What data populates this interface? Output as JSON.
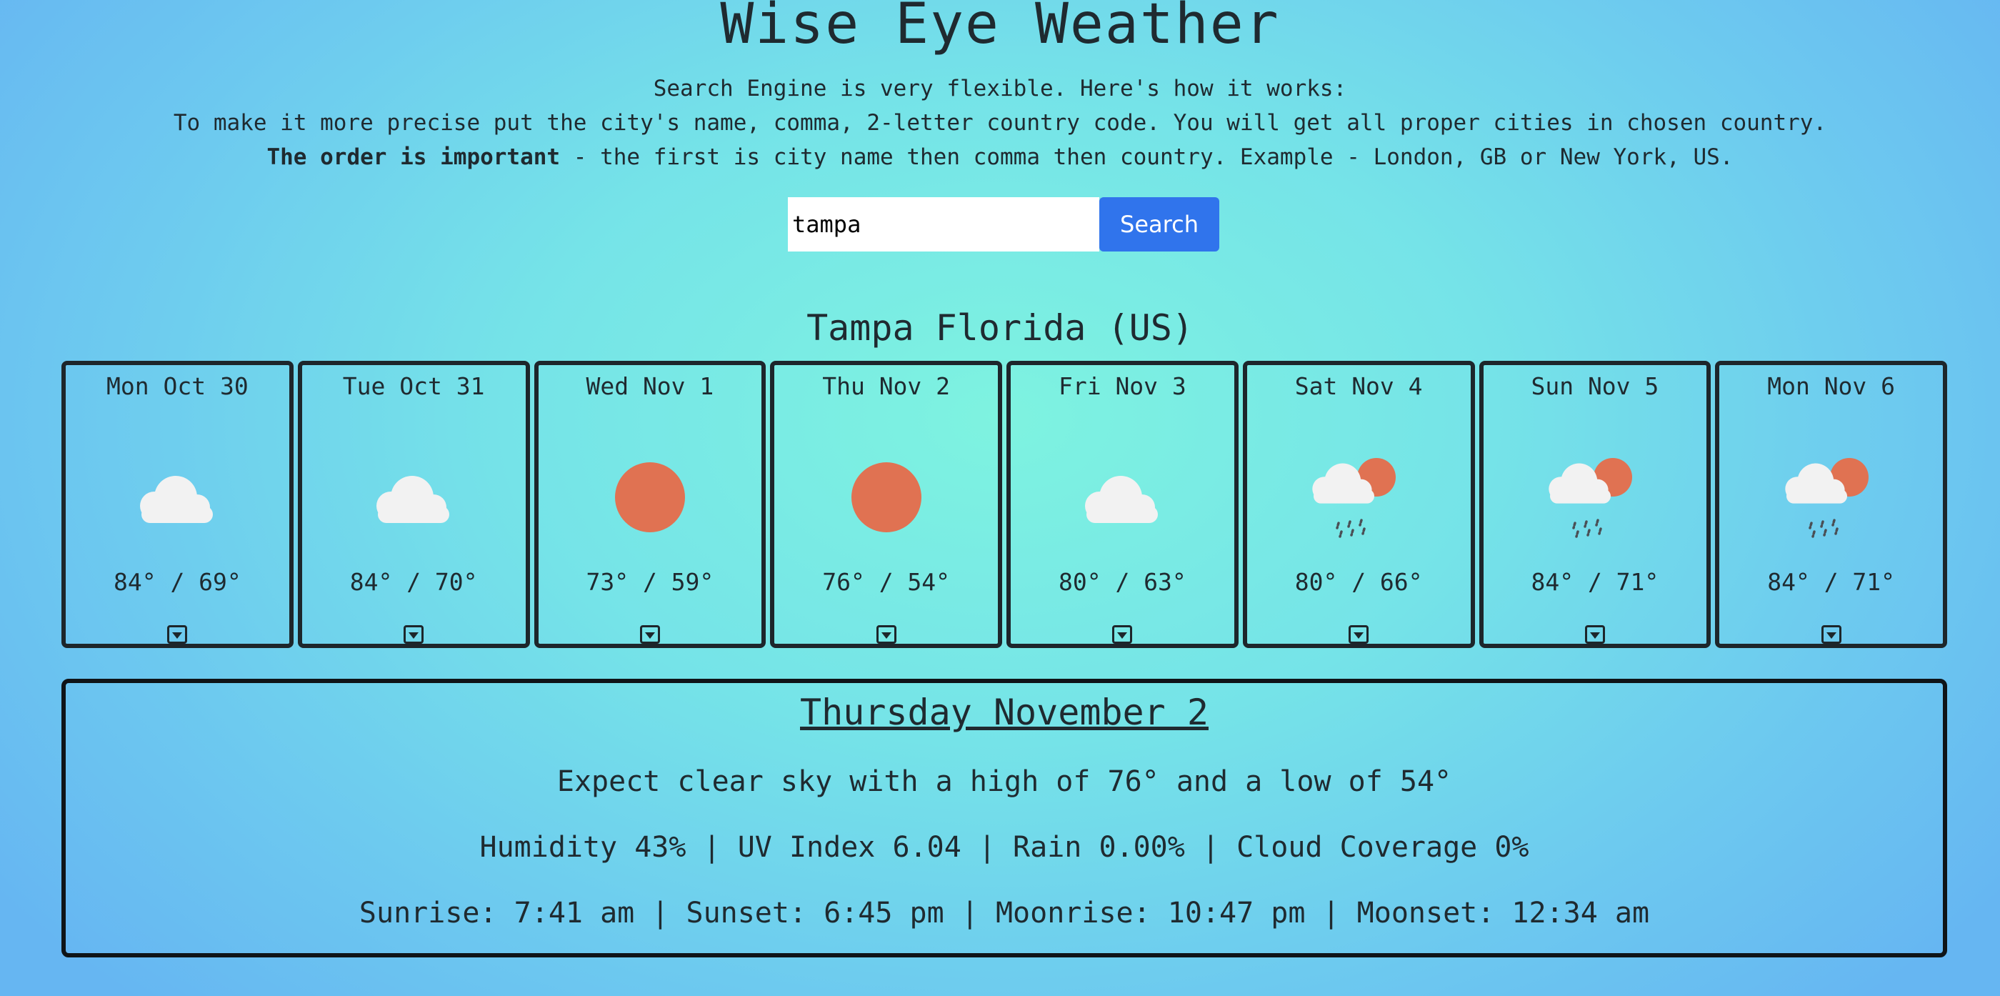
{
  "app": {
    "title": "Wise Eye Weather"
  },
  "instructions": {
    "line1": "Search Engine is very flexible. Here's how it works:",
    "line2": "To make it more precise put the city's name, comma, 2-letter country code. You will get all proper cities in chosen country.",
    "line3_bold": "The order is important",
    "line3_rest": " - the first is city name then comma then country. Example - London, GB or New York, US."
  },
  "search": {
    "value": "tampa",
    "button_label": "Search"
  },
  "location": {
    "title": "Tampa Florida (US)"
  },
  "forecast": [
    {
      "day": "Mon Oct 30",
      "temps": "84° / 69°",
      "icon": "cloud-icon"
    },
    {
      "day": "Tue Oct 31",
      "temps": "84° / 70°",
      "icon": "cloud-icon"
    },
    {
      "day": "Wed Nov 1",
      "temps": "73° / 59°",
      "icon": "sun-icon"
    },
    {
      "day": "Thu Nov 2",
      "temps": "76° / 54°",
      "icon": "sun-icon"
    },
    {
      "day": "Fri Nov 3",
      "temps": "80° / 63°",
      "icon": "cloud-icon"
    },
    {
      "day": "Sat Nov 4",
      "temps": "80° / 66°",
      "icon": "rain-sun-icon"
    },
    {
      "day": "Sun Nov 5",
      "temps": "84° / 71°",
      "icon": "rain-sun-icon"
    },
    {
      "day": "Mon Nov 6",
      "temps": "84° / 71°",
      "icon": "rain-sun-icon"
    }
  ],
  "details": {
    "title": "Thursday November 2",
    "summary": "Expect clear sky with a high of 76° and a low of 54°",
    "stats": "Humidity 43% | UV Index 6.04 | Rain 0.00% | Cloud Coverage 0%",
    "astro": "Sunrise: 7:41 am | Sunset: 6:45 pm | Moonrise: 10:47 pm | Moonset: 12:34 am"
  },
  "colors": {
    "accent_button": "#3074ec",
    "sun": "#e07252",
    "cloud": "#f2f2f2",
    "rain": "#4a4f55",
    "border": "#1d262b"
  }
}
